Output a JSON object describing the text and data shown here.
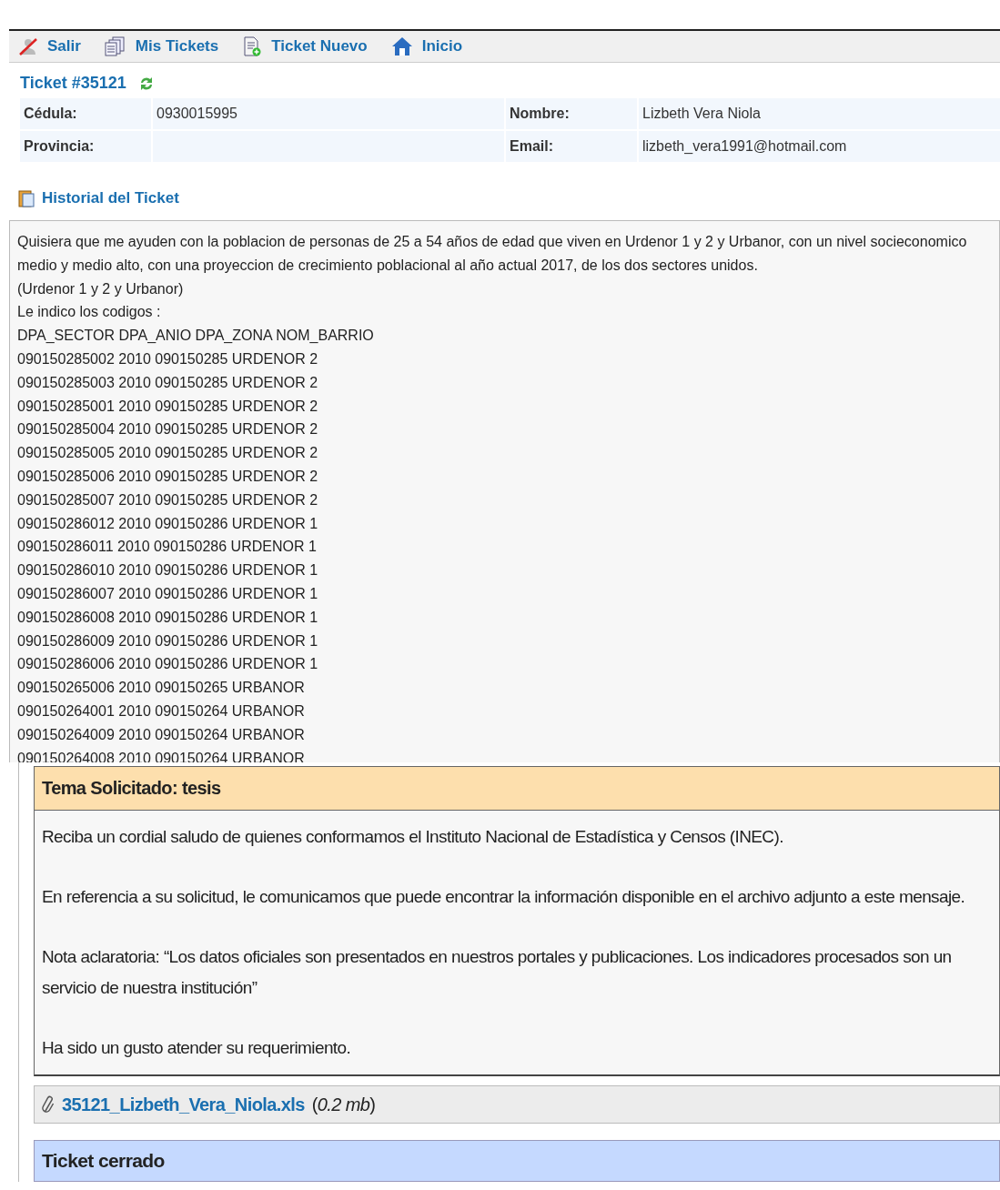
{
  "nav": [
    {
      "kind": "exit",
      "label": "Salir"
    },
    {
      "kind": "tickets",
      "label": "Mis Tickets"
    },
    {
      "kind": "new",
      "label": "Ticket Nuevo"
    },
    {
      "kind": "home",
      "label": "Inicio"
    }
  ],
  "ticket": {
    "title": "Ticket #35121"
  },
  "info": [
    [
      {
        "label": "Cédula:",
        "value": "0930015995"
      },
      {
        "label": "Nombre:",
        "value": "Lizbeth Vera Niola"
      }
    ],
    [
      {
        "label": "Provincia:"
      },
      {
        "label": "Email:",
        "value": "lizbeth_vera1991@hotmail.com"
      }
    ]
  ],
  "history": {
    "title": "Historial del Ticket"
  },
  "message": {
    "lines": [
      "Quisiera que me ayuden con la poblacion de personas de 25 a 54 años de edad que viven en Urdenor 1 y 2 y Urbanor, con un nivel socieconomico medio y medio alto, con una proyeccion de crecimiento poblacional al año actual 2017, de los dos sectores unidos.",
      "(Urdenor 1 y 2 y Urbanor)",
      "Le indico los codigos :",
      "DPA_SECTOR DPA_ANIO DPA_ZONA NOM_BARRIO",
      "090150285002 2010 090150285 URDENOR 2",
      "090150285003 2010 090150285 URDENOR 2",
      "090150285001 2010 090150285 URDENOR 2",
      "090150285004 2010 090150285 URDENOR 2",
      "090150285005 2010 090150285 URDENOR 2",
      "090150285006 2010 090150285 URDENOR 2",
      "090150285007 2010 090150285 URDENOR 2",
      "090150286012 2010 090150286 URDENOR 1",
      "090150286011 2010 090150286 URDENOR 1",
      "090150286010 2010 090150286 URDENOR 1",
      "090150286007 2010 090150286 URDENOR 1",
      "090150286008 2010 090150286 URDENOR 1",
      "090150286009 2010 090150286 URDENOR 1",
      "090150286006 2010 090150286 URDENOR 1",
      "090150265006 2010 090150265 URBANOR",
      "090150264001 2010 090150264 URBANOR",
      "090150264009 2010 090150264 URBANOR",
      "090150264008 2010 090150264 URBANOR"
    ]
  },
  "response": {
    "title": "Tema Solicitado: tesis",
    "paragraphs": [
      "Reciba un cordial saludo de quienes conformamos el Instituto Nacional de Estadística y Censos (INEC).",
      "En referencia a su solicitud, le comunicamos que puede encontrar la información disponible en el archivo adjunto a este mensaje.",
      "Nota aclaratoria: “Los datos oficiales son presentados en nuestros portales y publicaciones. Los indicadores procesados son un servicio de nuestra institución”",
      "Ha sido un gusto atender su requerimiento."
    ],
    "attachment": {
      "file": "35121_Lizbeth_Vera_Niola.xls",
      "size": "(*0.2 mb*)"
    }
  },
  "status": {
    "title": "Ticket cerrado"
  }
}
